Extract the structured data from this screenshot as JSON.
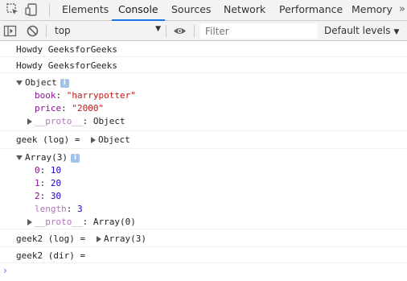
{
  "tabs": {
    "inspect_icon": "inspect-element-icon",
    "device_icon": "device-toolbar-icon",
    "items": [
      "Elements",
      "Console",
      "Sources",
      "Network",
      "Performance",
      "Memory"
    ],
    "active": "Console",
    "more_icon": "double-chevron-right-icon",
    "more_label": "»"
  },
  "toolbar": {
    "sidebar_icon": "show-console-sidebar-icon",
    "clear_icon": "clear-console-icon",
    "context": "top",
    "context_arrow": "▼",
    "eye_icon": "live-expression-eye-icon",
    "filter_placeholder": "Filter",
    "filter_value": "",
    "levels": "Default levels",
    "levels_arrow": "▼"
  },
  "console": {
    "msg1": "Howdy GeeksforGeeks",
    "msg2": "Howdy GeeksforGeeks",
    "obj_title": "Object",
    "obj_book_key": "book",
    "obj_book_val": "\"harrypotter\"",
    "obj_price_key": "price",
    "obj_price_val": "\"2000\"",
    "obj_proto_key": "__proto__",
    "obj_proto_val": "Object",
    "geek_label": "geek (log) = ",
    "geek_val": "Object",
    "arr_title": "Array(3)",
    "arr_i0": "0",
    "arr_v0": "10",
    "arr_i1": "1",
    "arr_v1": "20",
    "arr_i2": "2",
    "arr_v2": "30",
    "arr_len_key": "length",
    "arr_len_val": "3",
    "arr_proto_key": "__proto__",
    "arr_proto_val": "Array(0)",
    "geek2_log_label": "geek2 (log) = ",
    "geek2_log_val": "Array(3)",
    "geek2_dir_label": "geek2 (dir) = ",
    "info_badge": "i",
    "prompt": "›"
  },
  "colors": {
    "accent": "#1a73e8",
    "key": "#881391",
    "string": "#c41a16",
    "number": "#1c00cf",
    "prompt": "#367cf1"
  }
}
